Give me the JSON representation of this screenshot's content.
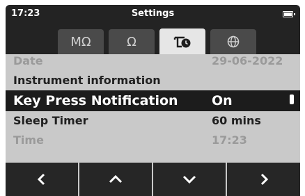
{
  "status": {
    "time": "17:23",
    "title": "Settings",
    "battery_icon": "battery-icon"
  },
  "tabs": [
    {
      "label": "MΩ",
      "icon": "megaohm-icon",
      "active": false
    },
    {
      "label": "Ω",
      "icon": "ohm-icon",
      "active": false
    },
    {
      "label": "",
      "icon": "settings-clock-icon",
      "active": true
    },
    {
      "label": "",
      "icon": "globe-icon",
      "active": false
    }
  ],
  "rows": [
    {
      "label": "Date",
      "value": "29-06-2022",
      "state": "faded"
    },
    {
      "label": "Instrument information",
      "value": "",
      "state": "normal"
    },
    {
      "label": "Key Press Notification",
      "value": "On",
      "state": "selected"
    },
    {
      "label": "Sleep Timer",
      "value": "60 mins",
      "state": "normal"
    },
    {
      "label": "Time",
      "value": "17:23",
      "state": "faded"
    }
  ],
  "nav": [
    {
      "icon": "chevron-left-icon"
    },
    {
      "icon": "chevron-up-icon"
    },
    {
      "icon": "chevron-down-icon"
    },
    {
      "icon": "chevron-right-icon"
    }
  ],
  "colors": {
    "background": "#c9c9c9",
    "bar": "#232323",
    "selected_row": "#1c1c1c",
    "active_tab": "#e6e6e6"
  }
}
